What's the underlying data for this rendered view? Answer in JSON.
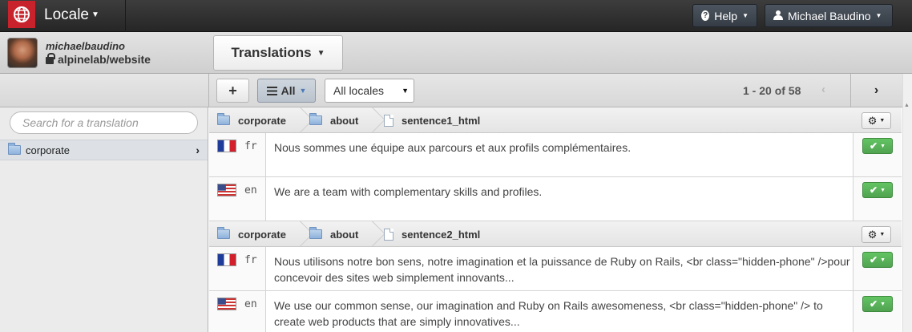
{
  "app": {
    "title": "Locale",
    "logo_icon": "globe-icon"
  },
  "topnav": {
    "help": "Help",
    "user": "Michael Baudino"
  },
  "project": {
    "username": "michaelbaudino",
    "repo": "alpinelab/website"
  },
  "section_button": "Translations",
  "toolbar": {
    "add": "+",
    "filter": "All",
    "locales_select": "All locales",
    "pagination": "1 - 20 of 58",
    "prev": "‹",
    "next": "›"
  },
  "sidebar": {
    "search_placeholder": "Search for a translation",
    "items": [
      {
        "label": "corporate"
      }
    ]
  },
  "groups": [
    {
      "breadcrumb": [
        "corporate",
        "about",
        "sentence1_html"
      ],
      "rows": [
        {
          "flag": "fr",
          "lang": "fr",
          "text": "Nous sommes une équipe aux parcours et aux profils complémentaires."
        },
        {
          "flag": "us",
          "lang": "en",
          "text": "We are a team with complementary skills and profiles."
        }
      ]
    },
    {
      "breadcrumb": [
        "corporate",
        "about",
        "sentence2_html"
      ],
      "rows": [
        {
          "flag": "fr",
          "lang": "fr",
          "text": "Nous utilisons notre bon sens, notre imagination et la puissance de Ruby on Rails, <br class=\"hidden-phone\" />pour concevoir des sites web simplement innovants..."
        },
        {
          "flag": "us",
          "lang": "en",
          "text": "We use our common sense, our imagination and Ruby on Rails awesomeness, <br class=\"hidden-phone\" /> to create web products that are simply innovatives..."
        }
      ]
    }
  ]
}
